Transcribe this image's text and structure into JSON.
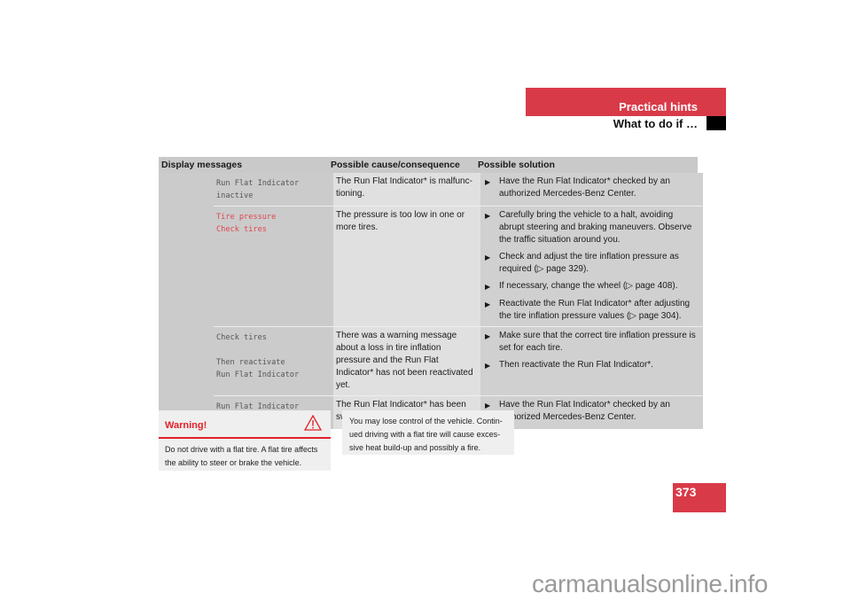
{
  "header": {
    "section_title": "Practical hints",
    "subsection_title": "What to do if …",
    "accent_color": "#d93a48"
  },
  "table": {
    "columns": [
      "Display messages",
      "Possible cause/consequence",
      "Possible solution"
    ],
    "rows": [
      {
        "message": "Run Flat Indicator\ninactive",
        "message_color": "#555555",
        "cause": "The Run Flat Indicator* is malfunc-tioning.",
        "solutions": [
          "Have the Run Flat Indicator* checked by an authorized Mercedes-Benz Center."
        ]
      },
      {
        "message": "Tire pressure\nCheck tires",
        "message_color": "#e0464f",
        "cause": "The pressure is too low in one or more tires.",
        "solutions": [
          "Carefully bring the vehicle to a halt, avoiding abrupt steering and braking maneuvers. Observe the traffic situation around you.",
          "Check and adjust the tire inflation pressure as required (▷ page 329).",
          "If necessary, change the wheel (▷ page 408).",
          "Reactivate the Run Flat Indicator* after adjusting the tire inflation pressure values (▷ page 304)."
        ]
      },
      {
        "message": "Check tires\n\nThen reactivate\nRun Flat Indicator",
        "message_color": "#555555",
        "cause": "There was a warning message about a loss in tire inflation pressure and the Run Flat Indicator* has not been reactivated yet.",
        "solutions": [
          "Make sure that the correct tire inflation pressure is set for each tire.",
          "Then reactivate the Run Flat Indicator*."
        ]
      },
      {
        "message": "Run Flat Indicator\nunavailable",
        "message_color": "#555555",
        "cause": "The Run Flat Indicator* has been switched off due to an error.",
        "solutions": [
          "Have the Run Flat Indicator* checked by an authorized Mercedes-Benz Center."
        ]
      }
    ],
    "bullet_icon": "arrow-right-icon"
  },
  "warning": {
    "title": "Warning!",
    "icon": "warning-triangle-icon",
    "body": "Do not drive with a flat tire. A flat tire affects the ability to steer or brake the vehicle.",
    "continuation": "You may lose control of the vehicle. Contin-ued driving with a flat tire will cause exces-sive heat build-up and possibly a fire.",
    "color": "#e3202a"
  },
  "page_number": "373",
  "watermark": "carmanualsonline.info"
}
